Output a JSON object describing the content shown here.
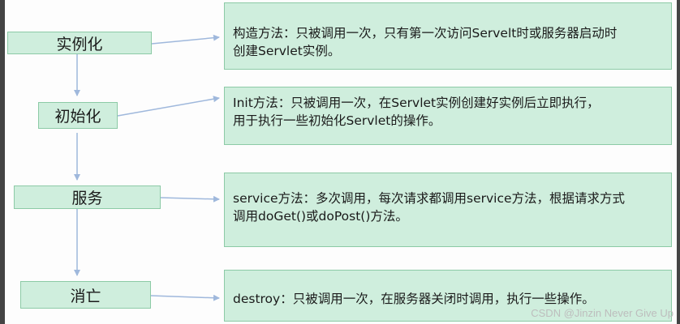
{
  "stages": [
    {
      "id": "instantiate",
      "label": "实例化"
    },
    {
      "id": "init",
      "label": "初始化"
    },
    {
      "id": "service",
      "label": "服务"
    },
    {
      "id": "destroy",
      "label": "消亡"
    }
  ],
  "descriptions": [
    {
      "lines": [
        "构造方法：只被调用一次，只有第一次访问Servelt时或服务器启动时",
        "创建Servlet实例。"
      ]
    },
    {
      "lines": [
        "Init方法：只被调用一次，在Servlet实例创建好实例后立即执行，",
        "用于执行一些初始化Servlet的操作。"
      ]
    },
    {
      "lines": [
        "service方法：多次调用，每次请求都调用service方法，根据请求方式",
        "调用doGet()或doPost()方法。"
      ]
    },
    {
      "lines": [
        "destroy：只被调用一次，在服务器关闭时调用，执行一些操作。"
      ]
    }
  ],
  "watermark": "CSDN @Jinzin Never Give Up",
  "colors": {
    "box_fill": "#cfeedd",
    "box_border": "#8ccaa6",
    "arrow": "#9fb8dc"
  }
}
